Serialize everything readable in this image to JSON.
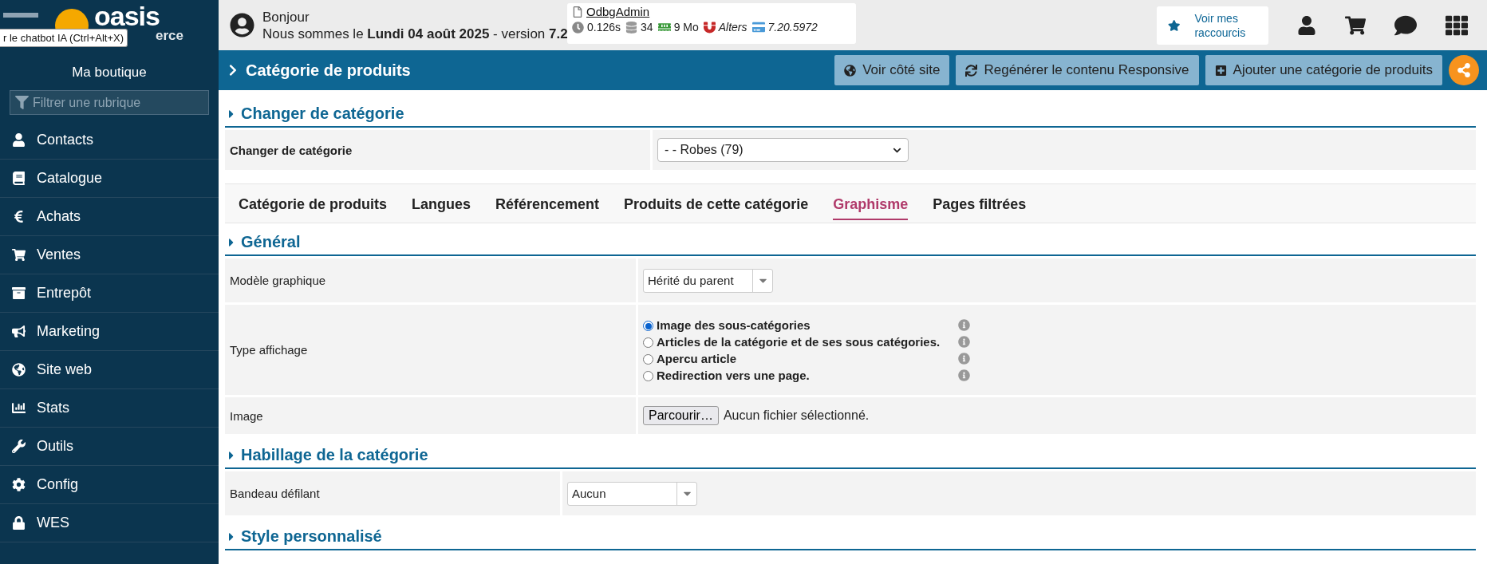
{
  "sidebar": {
    "logo": {
      "name": "oasis",
      "sub": "erce"
    },
    "tooltip": "r le chatbot IA (Ctrl+Alt+X)",
    "shop": "Ma boutique",
    "filter": {
      "placeholder": "Filtrer une rubrique"
    },
    "items": [
      {
        "label": "Contacts"
      },
      {
        "label": "Catalogue"
      },
      {
        "label": "Achats"
      },
      {
        "label": "Ventes"
      },
      {
        "label": "Entrepôt"
      },
      {
        "label": "Marketing"
      },
      {
        "label": "Site web"
      },
      {
        "label": "Stats"
      },
      {
        "label": "Outils"
      },
      {
        "label": "Config"
      },
      {
        "label": "WES"
      }
    ]
  },
  "header": {
    "greeting": "Bonjour",
    "date_line": "Nous sommes le **Lundi 04 août 2025** - version **7.2**",
    "debug": {
      "user": "OdbgAdmin",
      "time": "0.126s",
      "queries": "34",
      "memory": "9 Mo",
      "alters": "Alters",
      "version": "7.20.5972"
    },
    "shortcuts": "Voir mes raccourcis"
  },
  "page_bar": {
    "title": "Catégorie de produits",
    "buttons": [
      "Voir côté site",
      "Regénérer le contenu Responsive",
      "Ajouter une catégorie de produits"
    ]
  },
  "change_section": {
    "title": "Changer de catégorie",
    "label": "Changer de catégorie",
    "value": "- - Robes (79)"
  },
  "tabs": [
    {
      "label": "Catégorie de produits",
      "selected": false
    },
    {
      "label": "Langues",
      "selected": false
    },
    {
      "label": "Référencement",
      "selected": false
    },
    {
      "label": "Produits de cette catégorie",
      "selected": false
    },
    {
      "label": "Graphisme",
      "selected": true
    },
    {
      "label": "Pages filtrées",
      "selected": false
    }
  ],
  "sections": [
    {
      "title": "Général",
      "rows": [
        {
          "kind": "select",
          "label": "Modèle graphique",
          "value": "Hérité du parent"
        },
        {
          "kind": "radios",
          "label": "Type affichage",
          "options": [
            {
              "label": "Image des sous-catégories",
              "selected": true
            },
            {
              "label": "Articles de la catégorie et de ses sous catégories.",
              "selected": false
            },
            {
              "label": "Apercu article",
              "selected": false
            },
            {
              "label": "Redirection vers une page.",
              "selected": false
            }
          ]
        },
        {
          "kind": "file",
          "label": "Image",
          "button": "Parcourir…",
          "status": "Aucun fichier sélectionné."
        }
      ]
    },
    {
      "title": "Habillage de la catégorie",
      "rows": [
        {
          "kind": "select",
          "label": "Bandeau défilant",
          "value": "Aucun"
        }
      ]
    },
    {
      "title": "Style personnalisé"
    }
  ]
}
